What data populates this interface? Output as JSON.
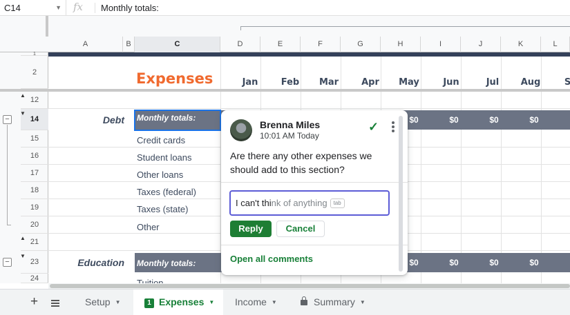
{
  "formula_bar": {
    "cell_ref": "C14",
    "fx_icon": "fx-icon",
    "value": "Monthly totals:"
  },
  "columns": [
    "A",
    "B",
    "C",
    "D",
    "E",
    "F",
    "G",
    "H",
    "I",
    "J",
    "K",
    "L"
  ],
  "selected_column": "C",
  "rows": [
    "1",
    "2",
    "12",
    "14",
    "15",
    "16",
    "17",
    "18",
    "19",
    "20",
    "21",
    "23",
    "24"
  ],
  "selected_row": "14",
  "sheet": {
    "title": "Expenses",
    "months": [
      "Jan",
      "Feb",
      "Mar",
      "Apr",
      "May",
      "Jun",
      "Jul",
      "Aug",
      "Se"
    ],
    "debt": {
      "section": "Debt",
      "totals_label": "Monthly totals:",
      "items": [
        "Credit cards",
        "Student loans",
        "Other loans",
        "Taxes (federal)",
        "Taxes (state)",
        "Other"
      ],
      "values": [
        "$0",
        "$0",
        "$0",
        "$0"
      ]
    },
    "education": {
      "section": "Education",
      "totals_label": "Monthly totals:",
      "first_item": "Tuition",
      "values": [
        "$0",
        "$0",
        "$0",
        "$0"
      ]
    }
  },
  "comment": {
    "author": "Brenna Miles",
    "time": "10:01 AM Today",
    "text": "Are there any other expenses we should add to this section?",
    "reply_typed": "I can't thi",
    "reply_suggestion": "nk of anything",
    "tab_hint": "tab",
    "reply_label": "Reply",
    "cancel_label": "Cancel",
    "open_all_label": "Open all comments",
    "accent": "#188038"
  },
  "tabs": {
    "add_icon": "+",
    "list_icon": "sheets-list-icon",
    "items": [
      {
        "label": "Setup",
        "active": false
      },
      {
        "label": "Expenses",
        "active": true,
        "badge": "1"
      },
      {
        "label": "Income",
        "active": false
      },
      {
        "label": "Summary",
        "active": false,
        "locked": true
      }
    ]
  },
  "colors": {
    "title": "#f06a2f",
    "header_band": "#34415a",
    "totals_band": "#6b7384",
    "selection": "#1a73e8"
  }
}
